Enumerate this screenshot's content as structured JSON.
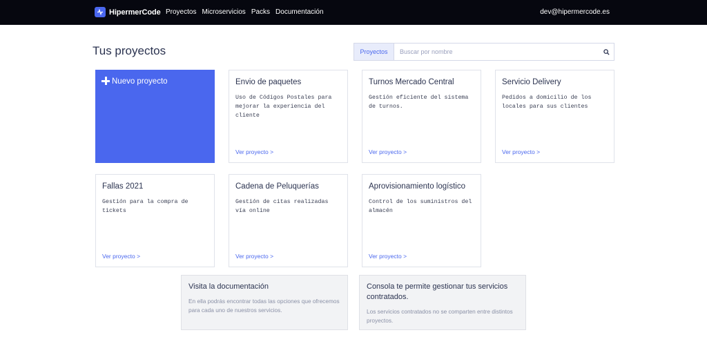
{
  "header": {
    "brand": "HipermerCode",
    "nav": [
      "Proyectos",
      "Microservicios",
      "Packs",
      "Documentación"
    ],
    "user_email": "dev@hipermercode.es"
  },
  "main": {
    "title": "Tus proyectos",
    "search": {
      "scope": "Proyectos",
      "placeholder": "Buscar por nombre",
      "value": ""
    },
    "new_project_label": "Nuevo proyecto",
    "projects": [
      {
        "title": "Envio de paquetes",
        "description": "Uso de Códigos Postales para mejorar la experiencia del cliente",
        "link": "Ver proyecto >"
      },
      {
        "title": "Turnos Mercado Central",
        "description": "Gestión eficiente del sistema de turnos.",
        "link": "Ver proyecto >"
      },
      {
        "title": "Servicio Delivery",
        "description": "Pedidos a domicilio de los locales para sus clientes",
        "link": "Ver proyecto >"
      },
      {
        "title": "Fallas 2021",
        "description": "Gestión para la compra de tickets",
        "link": "Ver proyecto >"
      },
      {
        "title": "Cadena de Peluquerías",
        "description": "Gestión de citas realizadas vía online",
        "link": "Ver proyecto >"
      },
      {
        "title": "Aprovisionamiento logístico",
        "description": "Control de los suministros del almacén",
        "link": "Ver proyecto >"
      }
    ],
    "info_boxes": [
      {
        "title": "Visita la documentación",
        "body": "En ella podrás encontrar todas las opciones que ofrecemos para cada uno de nuestros servicios."
      },
      {
        "title": "Consola te permite gestionar tus servicios contratados.",
        "body": "Los servicios contratados no se comparten entre distintos proyectos."
      }
    ]
  },
  "colors": {
    "accent": "#4a67ee",
    "topbar": "#06070f",
    "info_bg": "#f2f3f5"
  },
  "icons": [
    "logo-icon",
    "search-icon",
    "plus-icon"
  ]
}
